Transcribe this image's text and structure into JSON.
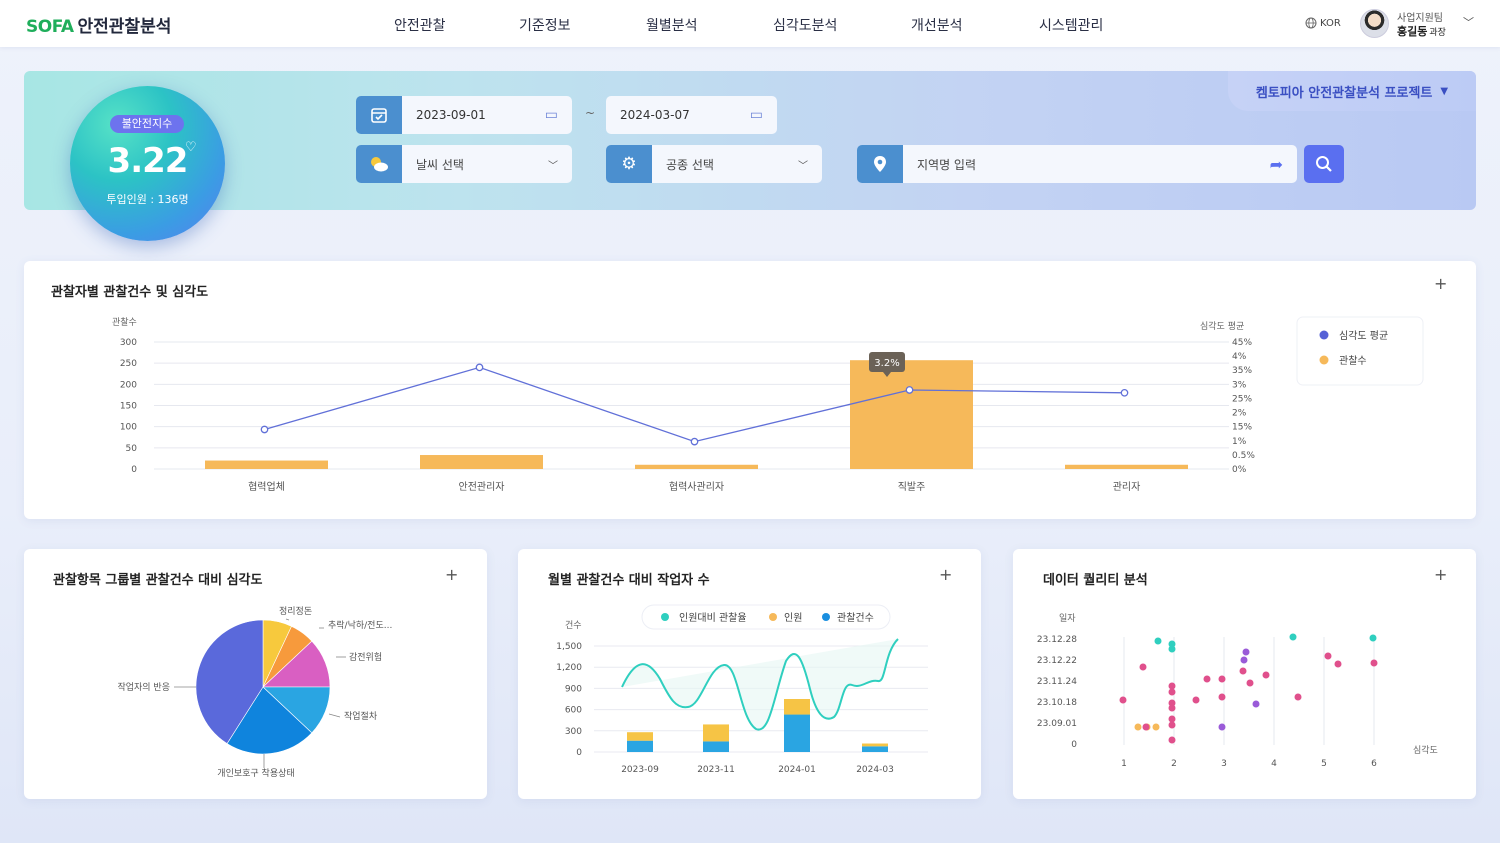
{
  "header": {
    "logo_brand": "SOFA",
    "logo_text": "안전관찰분석",
    "nav": [
      "안전관찰",
      "기준정보",
      "월별분석",
      "심각도분석",
      "개선분석",
      "시스템관리"
    ],
    "lang": "KOR",
    "user_team": "사업지원팀",
    "user_name": "홍길동",
    "user_rank": "과장"
  },
  "summary": {
    "badge": "불안전지수",
    "value": "3.22",
    "sub": "투입인원 : 136명"
  },
  "filters": {
    "date_start": "2023-09-01",
    "date_end": "2024-03-07",
    "tilde": "~",
    "weather": "날씨 선택",
    "work_type": "공종 선택",
    "region_placeholder": "지역명 입력",
    "project": "켐토피아 안전관찰분석 프로젝트"
  },
  "colors": {
    "accent": "#5a6ff0",
    "bar": "#f6b95a",
    "line": "#6170d8",
    "teal": "#2fcfbf",
    "blue": "#2aa5e2",
    "pink": "#e0508c",
    "purple": "#9a5bd8"
  },
  "observer_chart": {
    "title": "관찰자별 관찰건수 및 심각도",
    "left_axis_label": "관찰수",
    "right_axis_label": "심각도 평균",
    "left_ticks": [
      "300",
      "250",
      "200",
      "150",
      "100",
      "50",
      "0"
    ],
    "right_ticks": [
      "45%",
      "4%",
      "35%",
      "3%",
      "25%",
      "2%",
      "15%",
      "1%",
      "0.5%",
      "0%"
    ],
    "tooltip": "3.2%",
    "legend": [
      "심각도 평균",
      "관찰수"
    ],
    "chart_data": {
      "type": "bar",
      "categories": [
        "협력업체",
        "안전관리자",
        "협력사관리자",
        "직발주",
        "관리자"
      ],
      "series": [
        {
          "name": "관찰수",
          "values": [
            20,
            33,
            10,
            257,
            10
          ]
        },
        {
          "name": "심각도 평균",
          "values": [
            1.4,
            3.6,
            0.97,
            2.8,
            2.7
          ]
        }
      ],
      "ylim": [
        0,
        300
      ]
    }
  },
  "pie_chart": {
    "title": "관찰항목 그룹별 관찰건수 대비 심각도",
    "chart_data": {
      "type": "pie",
      "labels": [
        "정리정돈",
        "추락/낙하/전도...",
        "감전위험",
        "작업절차",
        "개인보호구 착용상태",
        "작업자의 반응"
      ],
      "values": [
        7,
        6,
        12,
        12,
        22,
        41
      ],
      "colors": [
        "#f7c93d",
        "#f79a3c",
        "#d95fc2",
        "#2aa5e2",
        "#0f84dd",
        "#5a69db"
      ]
    }
  },
  "monthly_chart": {
    "title": "월별 관찰건수 대비 작업자 수",
    "y_label": "건수",
    "y_ticks": [
      "1,500",
      "1,200",
      "900",
      "600",
      "300",
      "0"
    ],
    "legend": [
      "인원대비 관찰율",
      "인원",
      "관찰건수"
    ],
    "chart_data": {
      "type": "bar",
      "categories": [
        "2023-09",
        "2023-11",
        "2024-01",
        "2024-03"
      ],
      "series": [
        {
          "name": "관찰건수",
          "values": [
            160,
            150,
            530,
            80
          ]
        },
        {
          "name": "인원",
          "values": [
            120,
            240,
            220,
            40
          ]
        }
      ],
      "ylim": [
        0,
        1500
      ]
    }
  },
  "quality_chart": {
    "title": "데이터 퀄리티 분석",
    "y_label": "일자",
    "x_label": "심각도",
    "y_ticks": [
      "23.12.28",
      "23.12.22",
      "23.11.24",
      "23.10.18",
      "23.09.01",
      "0"
    ],
    "x_ticks": [
      "1",
      "2",
      "3",
      "4",
      "5",
      "6"
    ]
  }
}
